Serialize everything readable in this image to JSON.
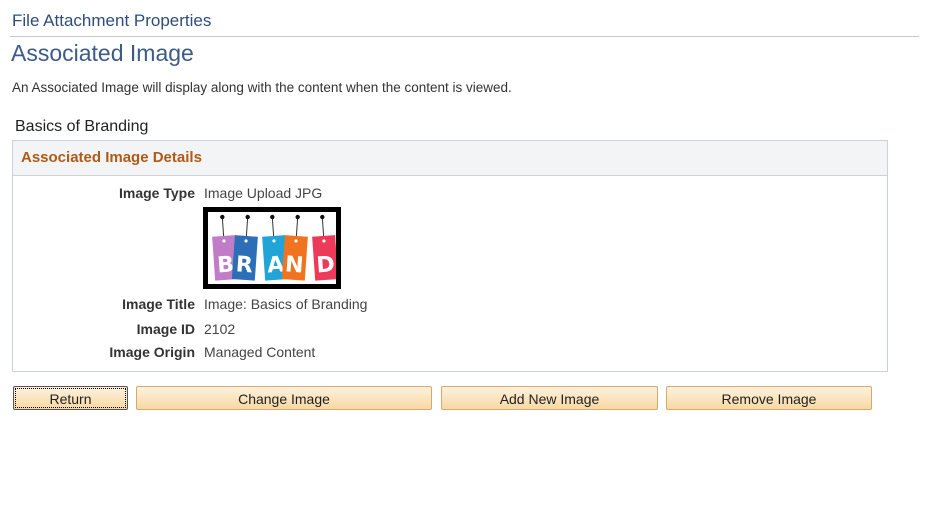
{
  "header": {
    "window_title": "File Attachment Properties",
    "page_title": "Associated Image",
    "intro": "An Associated Image will display along with the content when the content is viewed."
  },
  "content": {
    "name": "Basics of Branding"
  },
  "details": {
    "section_title": "Associated Image Details",
    "image_type": {
      "label": "Image Type",
      "value": "Image Upload JPG"
    },
    "image_title": {
      "label": "Image Title",
      "value": "Image: Basics of Branding"
    },
    "image_id": {
      "label": "Image ID",
      "value": "2102"
    },
    "image_origin": {
      "label": "Image Origin",
      "value": "Managed Content"
    },
    "thumbnail": {
      "tags": [
        {
          "letter": "B",
          "color": "#c07cc7"
        },
        {
          "letter": "R",
          "color": "#2c6fb7"
        },
        {
          "letter": "A",
          "color": "#21a4d8"
        },
        {
          "letter": "N",
          "color": "#f07420"
        },
        {
          "letter": "D",
          "color": "#ee3a5a"
        }
      ]
    }
  },
  "buttons": {
    "return": "Return",
    "change_image": "Change Image",
    "add_new_image": "Add New Image",
    "remove_image": "Remove Image"
  }
}
